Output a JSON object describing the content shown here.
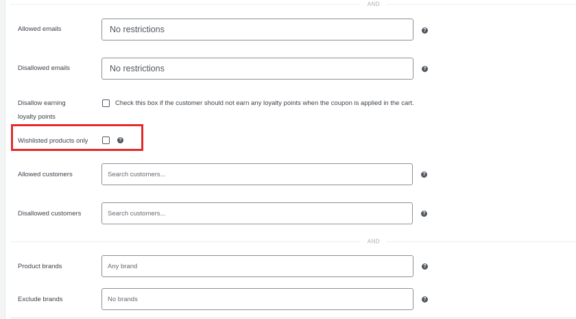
{
  "dividers": {
    "top": "AND",
    "middle": "AND"
  },
  "fields": {
    "allowed_emails": {
      "label": "Allowed emails",
      "value": "No restrictions",
      "help_icon": "question-circle"
    },
    "disallowed_emails": {
      "label": "Disallowed emails",
      "value": "No restrictions",
      "help_icon": "question-circle"
    },
    "disallow_loyalty": {
      "label_line1": "Disallow earning",
      "label_line2": "loyalty points",
      "checked": false,
      "description": "Check this box if the customer should not earn any loyalty points when the coupon is applied in the cart."
    },
    "wishlisted_only": {
      "label": "Wishlisted products only",
      "checked": false,
      "help_icon": "question-circle"
    },
    "allowed_customers": {
      "label": "Allowed customers",
      "placeholder": "Search customers...",
      "help_icon": "question-circle"
    },
    "disallowed_customers": {
      "label": "Disallowed customers",
      "placeholder": "Search customers...",
      "help_icon": "question-circle"
    },
    "product_brands": {
      "label": "Product brands",
      "placeholder": "Any brand",
      "help_icon": "question-circle"
    },
    "exclude_brands": {
      "label": "Exclude brands",
      "placeholder": "No brands",
      "help_icon": "question-circle"
    }
  },
  "help_glyph": "?",
  "highlight_color": "#e32929"
}
